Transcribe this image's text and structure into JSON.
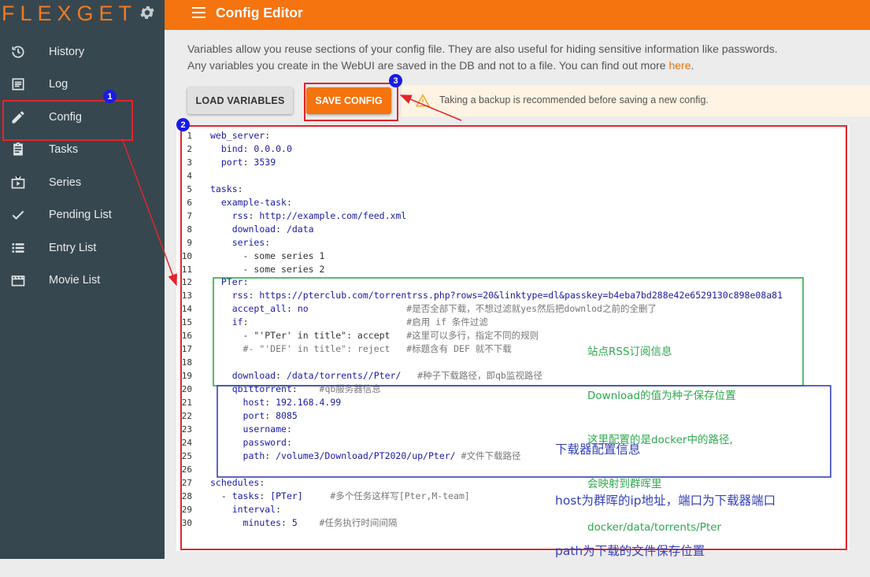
{
  "app": {
    "logo": "FLEXGET",
    "logo_icon": "gear-icon",
    "page_title": "Config Editor",
    "menu_icon": "hamburger-menu-icon"
  },
  "sidebar": {
    "items": [
      {
        "label": "History",
        "icon": "history-icon"
      },
      {
        "label": "Log",
        "icon": "log-icon"
      },
      {
        "label": "Config",
        "icon": "pencil-icon"
      },
      {
        "label": "Tasks",
        "icon": "clipboard-icon"
      },
      {
        "label": "Series",
        "icon": "tv-icon"
      },
      {
        "label": "Pending List",
        "icon": "check-icon"
      },
      {
        "label": "Entry List",
        "icon": "list-icon"
      },
      {
        "label": "Movie List",
        "icon": "film-icon"
      }
    ]
  },
  "intro": {
    "line1": "Variables allow you reuse sections of your config file. They are also useful for hiding sensitive information like passwords.",
    "line2_prefix": "Any variables you create in the WebUI are saved in the DB and not to a file. You can find out more ",
    "link_text": "here",
    "line2_suffix": "."
  },
  "toolbar": {
    "load_label": "LOAD VARIABLES",
    "save_label": "SAVE CONFIG",
    "warning_text": "Taking a backup is recommended before saving a new config."
  },
  "editor": {
    "lines": [
      "web_server:",
      "  bind: 0.0.0.0",
      "  port: 3539",
      "",
      "tasks:",
      "  example-task:",
      "    rss: http://example.com/feed.xml",
      "    download: /data",
      "    series:",
      "      - some series 1",
      "      - some series 2",
      "  PTer:",
      "    rss: https://pterclub.com/torrentrss.php?rows=20&linktype=dl&passkey=b4eba7bd288e42e6529130c898e08a81",
      "    accept_all: no                  #是否全部下载，不想过滤就yes然后把downlod之前的全删了",
      "    if:                             #启用 if 条件过滤",
      "      - \"'PTer' in title\": accept   #这里可以多行，指定不同的规则",
      "      #- \"'DEF' in title\": reject   #标题含有 DEF 就不下载",
      "",
      "    download: /data/torrents//Pter/   #种子下载路径，即qb监视路径",
      "    qbittorrent:    #qb服务器信息",
      "      host: 192.168.4.99",
      "      port: 8085",
      "      username: ",
      "      password: ",
      "      path: /volume3/Download/PT2020/up/Pter/ #文件下载路径",
      "",
      "schedules:",
      "  - tasks: [PTer]     #多个任务这样写[Pter,M-team]",
      "    interval:",
      "      minutes: 5    #任务执行时间间隔"
    ]
  },
  "annotations": {
    "badges": [
      "1",
      "2",
      "3"
    ],
    "green_note": [
      "站点RSS订阅信息",
      "Download的值为种子保存位置",
      "这里配置的是docker中的路径,",
      "会映射到群晖里",
      "docker/data/torrents/Pter"
    ],
    "blue_note": [
      "下载器配置信息",
      "host为群晖的ip地址，端口为下载器端口",
      "path为下载的文件保存位置"
    ],
    "colors": {
      "red": "#e3242b",
      "green": "#2fa84f",
      "blue": "#3441b8",
      "badge_blue": "#1a1ae6"
    }
  }
}
